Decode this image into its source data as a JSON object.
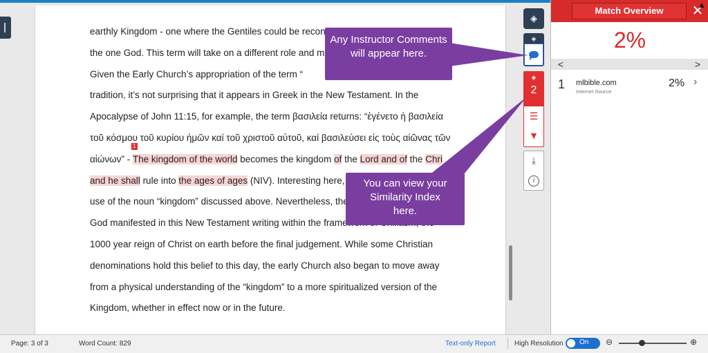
{
  "document": {
    "lines": [
      {
        "segments": [
          {
            "t": "earthly Kingdom - one where the Gentiles could be reconc",
            "hl": false
          }
        ]
      },
      {
        "segments": [
          {
            "t": "the one God. This term will take on a different role and me",
            "hl": false
          }
        ]
      },
      {
        "segments": [
          {
            "t": "            Given the Early Church’s appropriation of the term “",
            "hl": false
          }
        ]
      },
      {
        "segments": [
          {
            "t": "tradition, it’s not surprising that it appears in Greek in the New Testament. In the",
            "hl": false
          }
        ]
      },
      {
        "segments": [
          {
            "t": "Apocalypse of John 11:15, for example, the term βασιλεία returns: “ἐγένετο ἡ βασιλεία",
            "hl": false
          }
        ]
      },
      {
        "segments": [
          {
            "t": "τοῦ κόσμου τοῦ κυρίου ἡμῶν καί τοῦ χριστοῦ αὐτοῦ, καί βασιλεύσει εἰς τοὺς αἰῶνας τῶν",
            "hl": false
          }
        ]
      },
      {
        "segments": [
          {
            "t": "αἰώνων” - ",
            "hl": false
          },
          {
            "t": "The kingdom of the world",
            "hl": true
          },
          {
            "t": " becomes the kingdom ",
            "hl": false
          },
          {
            "t": "of",
            "hl": true
          },
          {
            "t": " the ",
            "hl": false
          },
          {
            "t": "Lord and of",
            "hl": true
          },
          {
            "t": " the ",
            "hl": false
          },
          {
            "t": "Chri",
            "hl": true
          }
        ]
      },
      {
        "segments": [
          {
            "t": "and he shall",
            "hl": true
          },
          {
            "t": " rule into ",
            "hl": false
          },
          {
            "t": "the ages of ages",
            "hl": true
          },
          {
            "t": " (NIV). Interesting here,",
            "hl": false
          }
        ]
      },
      {
        "segments": [
          {
            "t": "use of the noun “kingdom” discussed above. Nevertheless, the",
            "hl": false
          }
        ]
      },
      {
        "segments": [
          {
            "t": "God manifested in this New Testament writing within the framework of Chiliasm, the",
            "hl": false
          }
        ]
      },
      {
        "segments": [
          {
            "t": "1000 year reign of Christ on earth before the final judgement. While some Christian",
            "hl": false
          }
        ]
      },
      {
        "segments": [
          {
            "t": "denominations hold this belief to this day, the early Church also began to move away",
            "hl": false
          }
        ]
      },
      {
        "segments": [
          {
            "t": "from a physical understanding of the “kingdom” to a more spiritualized version of the",
            "hl": false
          }
        ]
      },
      {
        "segments": [
          {
            "t": "Kingdom, whether in effect now or in the future.",
            "hl": false
          }
        ]
      }
    ],
    "match_marker": "1"
  },
  "toolbar": {
    "similarity_count": "2",
    "layers_icon": "layers-icon",
    "comment_icon": "comment-icon",
    "filter_icon": "filter-icon",
    "sort_icon": "sort-icon",
    "download_icon": "download-icon",
    "info_icon": "info-icon",
    "info_glyph": "i"
  },
  "panel": {
    "title": "Match Overview",
    "close": "✕",
    "percent": "2%",
    "nav_prev": "<",
    "nav_next": ">",
    "matches": [
      {
        "num": "1",
        "source": "mlbible.com",
        "type": "Internet Source",
        "percent": "2%"
      }
    ]
  },
  "status": {
    "page": "Page: 3 of 3",
    "word_count": "Word Count: 829",
    "text_only": "Text-only Report",
    "high_res": "High Resolution",
    "toggle": "On",
    "zoom_out": "⊖",
    "zoom_in": "⊕"
  },
  "callouts": {
    "comments": "Any Instructor Comments will appear here.",
    "similarity": "You can view your Similarity Index here."
  },
  "colors": {
    "brand_red": "#d72b2b",
    "accent_blue": "#1f6fd0",
    "callout_purple": "#7a3ea1",
    "highlight": "#f8d4d4"
  }
}
